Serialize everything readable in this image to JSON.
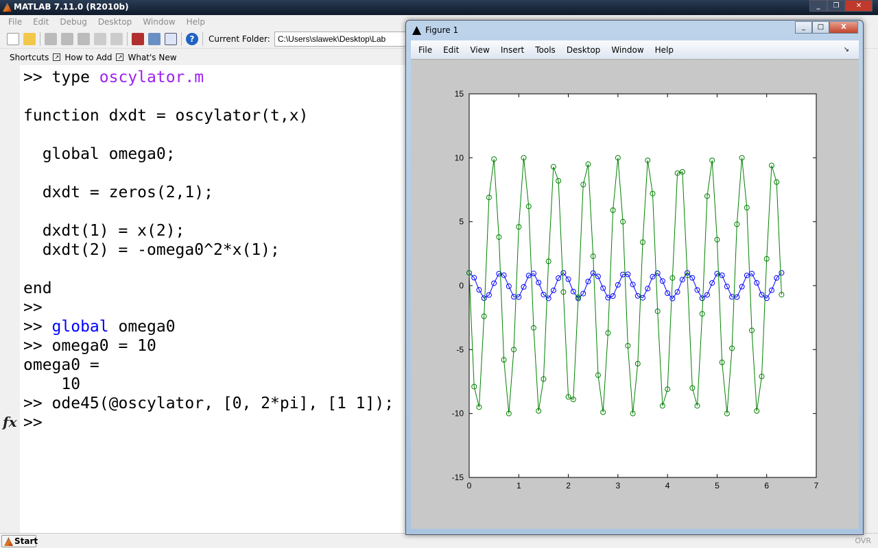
{
  "app": {
    "title": "MATLAB  7.11.0 (R2010b)"
  },
  "menu": [
    "File",
    "Edit",
    "Debug",
    "Desktop",
    "Window",
    "Help"
  ],
  "toolbar": {
    "current_folder_label": "Current Folder:",
    "current_folder_value": "C:\\Users\\slawek\\Desktop\\Lab"
  },
  "shortcuts": {
    "label": "Shortcuts",
    "items": [
      "How to Add",
      "What's New"
    ]
  },
  "console": {
    "l1_prompt": ">> type ",
    "l1_file": "oscylator.m",
    "l2": "function dxdt = oscylator(t,x)",
    "l3": "  global omega0;",
    "l4": "  dxdt = zeros(2,1);",
    "l5": "  dxdt(1) = x(2);",
    "l6": "  dxdt(2) = -omega0^2*x(1);",
    "l7": "end",
    "l8": ">>",
    "l9_prompt": ">> ",
    "l9_kw": "global",
    "l9_rest": " omega0",
    "l10": ">> omega0 = 10",
    "l11": "omega0 =",
    "l12": "    10",
    "l13": ">> ode45(@oscylator, [0, 2*pi], [1 1]);",
    "l14": ">>",
    "fx": "fx"
  },
  "status": {
    "start": "Start",
    "ovr": "OVR"
  },
  "figure": {
    "title": "Figure 1",
    "menu": [
      "File",
      "Edit",
      "View",
      "Insert",
      "Tools",
      "Desktop",
      "Window",
      "Help"
    ]
  },
  "chart_data": {
    "type": "line",
    "title": "",
    "xlabel": "",
    "ylabel": "",
    "xlim": [
      0,
      7
    ],
    "ylim": [
      -15,
      15
    ],
    "xticks": [
      0,
      1,
      2,
      3,
      4,
      5,
      6,
      7
    ],
    "yticks": [
      -15,
      -10,
      -5,
      0,
      5,
      10,
      15
    ],
    "grid": false,
    "legend": "none",
    "marker": "o",
    "x": [
      0,
      0.1,
      0.2,
      0.3,
      0.4,
      0.5,
      0.6,
      0.7,
      0.8,
      0.9,
      1.0,
      1.1,
      1.2,
      1.3,
      1.4,
      1.5,
      1.6,
      1.7,
      1.8,
      1.9,
      2.0,
      2.1,
      2.2,
      2.3,
      2.4,
      2.5,
      2.6,
      2.7,
      2.8,
      2.9,
      3.0,
      3.1,
      3.2,
      3.3,
      3.4,
      3.5,
      3.6,
      3.7,
      3.8,
      3.9,
      4.0,
      4.1,
      4.2,
      4.3,
      4.4,
      4.5,
      4.6,
      4.7,
      4.8,
      4.9,
      5.0,
      5.1,
      5.2,
      5.3,
      5.4,
      5.5,
      5.6,
      5.7,
      5.8,
      5.9,
      6.0,
      6.1,
      6.2,
      6.3
    ],
    "series": [
      {
        "color": "#0000ff",
        "values": [
          1.0,
          0.62,
          -0.33,
          -0.98,
          -0.73,
          0.19,
          0.93,
          0.82,
          -0.05,
          -0.87,
          -0.89,
          -0.1,
          0.79,
          0.95,
          0.24,
          -0.7,
          -0.99,
          -0.37,
          0.59,
          1.0,
          0.5,
          -0.46,
          -1.0,
          -0.62,
          0.33,
          0.98,
          0.72,
          -0.2,
          -0.94,
          -0.81,
          0.06,
          0.87,
          0.89,
          0.09,
          -0.8,
          -0.95,
          -0.23,
          0.7,
          0.98,
          0.36,
          -0.59,
          -1.0,
          -0.49,
          0.47,
          1.0,
          0.61,
          -0.34,
          -0.98,
          -0.72,
          0.21,
          0.94,
          0.81,
          -0.07,
          -0.88,
          -0.89,
          -0.08,
          0.8,
          0.94,
          0.22,
          -0.71,
          -0.98,
          -0.36,
          0.6,
          1.0
        ]
      },
      {
        "color": "#008000",
        "values": [
          1.0,
          -7.9,
          -9.5,
          -2.4,
          6.9,
          9.9,
          3.8,
          -5.8,
          -10.0,
          -5.0,
          4.6,
          10.0,
          6.2,
          -3.3,
          -9.8,
          -7.3,
          1.9,
          9.3,
          8.2,
          -0.5,
          -8.7,
          -8.9,
          -0.9,
          7.9,
          9.5,
          2.3,
          -7.0,
          -9.9,
          -3.7,
          5.9,
          10.0,
          5.0,
          -4.7,
          -10.0,
          -6.1,
          3.4,
          9.8,
          7.2,
          -2.0,
          -9.4,
          -8.1,
          0.6,
          8.8,
          8.9,
          0.8,
          -8.0,
          -9.4,
          -2.2,
          7.0,
          9.8,
          3.6,
          -6.0,
          -10.0,
          -4.9,
          4.8,
          10.0,
          6.1,
          -3.5,
          -9.8,
          -7.1,
          2.1,
          9.4,
          8.1,
          -0.7
        ]
      }
    ]
  }
}
